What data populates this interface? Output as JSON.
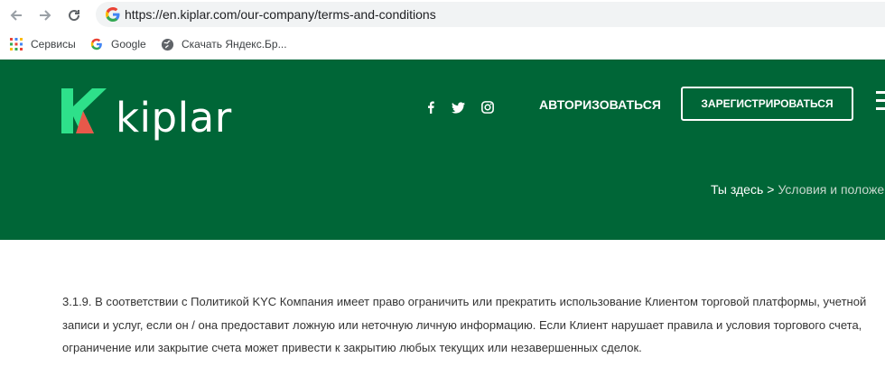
{
  "browser": {
    "url": "https://en.kiplar.com/our-company/terms-and-conditions",
    "bookmarks": [
      {
        "label": "Сервисы",
        "icon": "apps-grid-icon"
      },
      {
        "label": "Google",
        "icon": "google-icon"
      },
      {
        "label": "Скачать Яндекс.Бр...",
        "icon": "globe-icon"
      }
    ]
  },
  "site": {
    "logo_text": "kiplar",
    "nav": {
      "login": "АВТОРИЗОВАТЬСЯ",
      "register": "ЗАРЕГИСТРИРОВАТЬСЯ"
    },
    "social": [
      "facebook-icon",
      "twitter-icon",
      "instagram-icon"
    ],
    "breadcrumb": {
      "prefix": "Ты здесь",
      "separator": ">",
      "current": "Условия и положен"
    },
    "colors": {
      "header_bg": "#006637",
      "logo_green": "#2ee08a",
      "logo_red": "#e8584a"
    }
  },
  "content": {
    "paragraph": "3.1.9. В соответствии с Политикой KYC Компания имеет право ограничить или прекратить использование Клиентом торговой платформы, учетной записи и услуг, если он / она предоставит ложную или неточную личную информацию. Если Клиент нарушает правила и условия торгового счета, ограничение или закрытие счета может привести к закрытию любых текущих или незавершенных сделок."
  }
}
